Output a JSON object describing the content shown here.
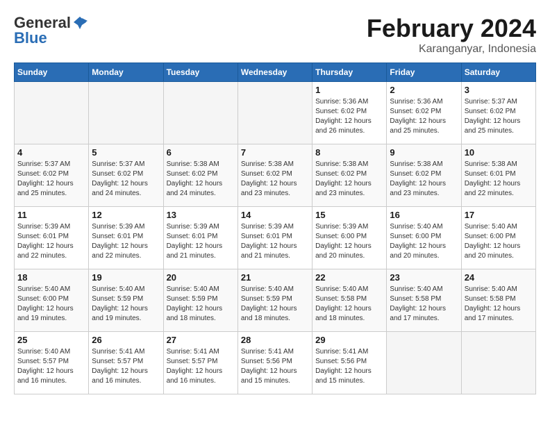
{
  "logo": {
    "general": "General",
    "blue": "Blue"
  },
  "title": "February 2024",
  "subtitle": "Karanganyar, Indonesia",
  "headers": [
    "Sunday",
    "Monday",
    "Tuesday",
    "Wednesday",
    "Thursday",
    "Friday",
    "Saturday"
  ],
  "weeks": [
    [
      {
        "day": "",
        "info": ""
      },
      {
        "day": "",
        "info": ""
      },
      {
        "day": "",
        "info": ""
      },
      {
        "day": "",
        "info": ""
      },
      {
        "day": "1",
        "info": "Sunrise: 5:36 AM\nSunset: 6:02 PM\nDaylight: 12 hours\nand 26 minutes."
      },
      {
        "day": "2",
        "info": "Sunrise: 5:36 AM\nSunset: 6:02 PM\nDaylight: 12 hours\nand 25 minutes."
      },
      {
        "day": "3",
        "info": "Sunrise: 5:37 AM\nSunset: 6:02 PM\nDaylight: 12 hours\nand 25 minutes."
      }
    ],
    [
      {
        "day": "4",
        "info": "Sunrise: 5:37 AM\nSunset: 6:02 PM\nDaylight: 12 hours\nand 25 minutes."
      },
      {
        "day": "5",
        "info": "Sunrise: 5:37 AM\nSunset: 6:02 PM\nDaylight: 12 hours\nand 24 minutes."
      },
      {
        "day": "6",
        "info": "Sunrise: 5:38 AM\nSunset: 6:02 PM\nDaylight: 12 hours\nand 24 minutes."
      },
      {
        "day": "7",
        "info": "Sunrise: 5:38 AM\nSunset: 6:02 PM\nDaylight: 12 hours\nand 23 minutes."
      },
      {
        "day": "8",
        "info": "Sunrise: 5:38 AM\nSunset: 6:02 PM\nDaylight: 12 hours\nand 23 minutes."
      },
      {
        "day": "9",
        "info": "Sunrise: 5:38 AM\nSunset: 6:02 PM\nDaylight: 12 hours\nand 23 minutes."
      },
      {
        "day": "10",
        "info": "Sunrise: 5:38 AM\nSunset: 6:01 PM\nDaylight: 12 hours\nand 22 minutes."
      }
    ],
    [
      {
        "day": "11",
        "info": "Sunrise: 5:39 AM\nSunset: 6:01 PM\nDaylight: 12 hours\nand 22 minutes."
      },
      {
        "day": "12",
        "info": "Sunrise: 5:39 AM\nSunset: 6:01 PM\nDaylight: 12 hours\nand 22 minutes."
      },
      {
        "day": "13",
        "info": "Sunrise: 5:39 AM\nSunset: 6:01 PM\nDaylight: 12 hours\nand 21 minutes."
      },
      {
        "day": "14",
        "info": "Sunrise: 5:39 AM\nSunset: 6:01 PM\nDaylight: 12 hours\nand 21 minutes."
      },
      {
        "day": "15",
        "info": "Sunrise: 5:39 AM\nSunset: 6:00 PM\nDaylight: 12 hours\nand 20 minutes."
      },
      {
        "day": "16",
        "info": "Sunrise: 5:40 AM\nSunset: 6:00 PM\nDaylight: 12 hours\nand 20 minutes."
      },
      {
        "day": "17",
        "info": "Sunrise: 5:40 AM\nSunset: 6:00 PM\nDaylight: 12 hours\nand 20 minutes."
      }
    ],
    [
      {
        "day": "18",
        "info": "Sunrise: 5:40 AM\nSunset: 6:00 PM\nDaylight: 12 hours\nand 19 minutes."
      },
      {
        "day": "19",
        "info": "Sunrise: 5:40 AM\nSunset: 5:59 PM\nDaylight: 12 hours\nand 19 minutes."
      },
      {
        "day": "20",
        "info": "Sunrise: 5:40 AM\nSunset: 5:59 PM\nDaylight: 12 hours\nand 18 minutes."
      },
      {
        "day": "21",
        "info": "Sunrise: 5:40 AM\nSunset: 5:59 PM\nDaylight: 12 hours\nand 18 minutes."
      },
      {
        "day": "22",
        "info": "Sunrise: 5:40 AM\nSunset: 5:58 PM\nDaylight: 12 hours\nand 18 minutes."
      },
      {
        "day": "23",
        "info": "Sunrise: 5:40 AM\nSunset: 5:58 PM\nDaylight: 12 hours\nand 17 minutes."
      },
      {
        "day": "24",
        "info": "Sunrise: 5:40 AM\nSunset: 5:58 PM\nDaylight: 12 hours\nand 17 minutes."
      }
    ],
    [
      {
        "day": "25",
        "info": "Sunrise: 5:40 AM\nSunset: 5:57 PM\nDaylight: 12 hours\nand 16 minutes."
      },
      {
        "day": "26",
        "info": "Sunrise: 5:41 AM\nSunset: 5:57 PM\nDaylight: 12 hours\nand 16 minutes."
      },
      {
        "day": "27",
        "info": "Sunrise: 5:41 AM\nSunset: 5:57 PM\nDaylight: 12 hours\nand 16 minutes."
      },
      {
        "day": "28",
        "info": "Sunrise: 5:41 AM\nSunset: 5:56 PM\nDaylight: 12 hours\nand 15 minutes."
      },
      {
        "day": "29",
        "info": "Sunrise: 5:41 AM\nSunset: 5:56 PM\nDaylight: 12 hours\nand 15 minutes."
      },
      {
        "day": "",
        "info": ""
      },
      {
        "day": "",
        "info": ""
      }
    ]
  ]
}
